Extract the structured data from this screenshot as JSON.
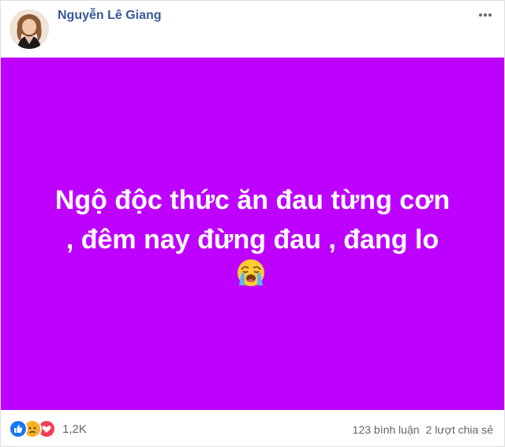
{
  "post": {
    "author": "Nguyễn Lê Giang",
    "status_text": "Ngộ độc thức ăn đau từng cơn\n, đêm nay đừng đau , đang lo",
    "status_background": "#bd00ff",
    "status_emoji": "crying-face"
  },
  "reactions": {
    "icons": [
      "like",
      "sad",
      "love"
    ],
    "count": "1,2K"
  },
  "stats": {
    "comments": "123 bình luận",
    "shares": "2 lượt chia sẻ"
  },
  "colors": {
    "name": "#385898",
    "meta": "#606770",
    "like": "#1877f2",
    "love": "#f33e58",
    "sad": "#f7b125"
  }
}
